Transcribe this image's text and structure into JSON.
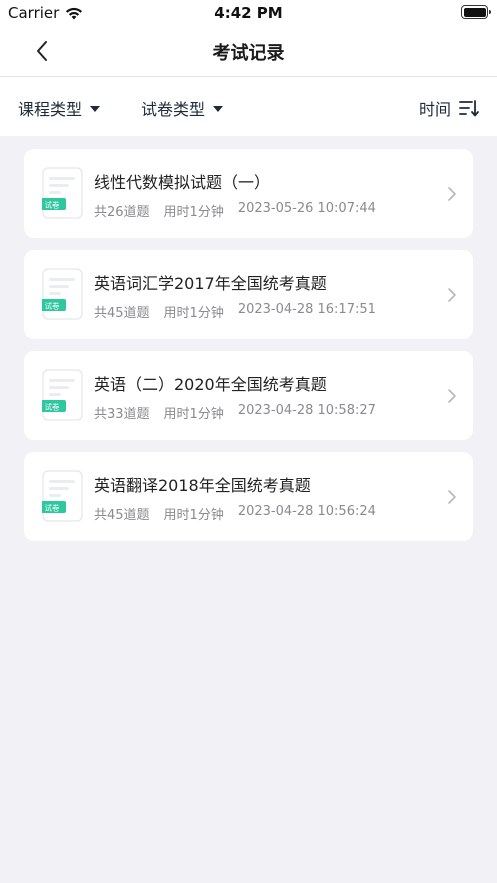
{
  "status": {
    "carrier": "Carrier",
    "time": "4:42 PM"
  },
  "nav": {
    "title": "考试记录"
  },
  "filters": {
    "course_type": "课程类型",
    "paper_type": "试卷类型",
    "time": "时间"
  },
  "records": [
    {
      "title": "线性代数模拟试题（一）",
      "count": "共26道题",
      "duration": "用时1分钟",
      "datetime": "2023-05-26 10:07:44",
      "badge": "试卷"
    },
    {
      "title": "英语词汇学2017年全国统考真题",
      "count": "共45道题",
      "duration": "用时1分钟",
      "datetime": "2023-04-28 16:17:51",
      "badge": "试卷"
    },
    {
      "title": "英语（二）2020年全国统考真题",
      "count": "共33道题",
      "duration": "用时1分钟",
      "datetime": "2023-04-28 10:58:27",
      "badge": "试卷"
    },
    {
      "title": "英语翻译2018年全国统考真题",
      "count": "共45道题",
      "duration": "用时1分钟",
      "datetime": "2023-04-28 10:56:24",
      "badge": "试卷"
    }
  ],
  "colors": {
    "accent": "#2ec7a0",
    "background": "#f2f2f6"
  },
  "icons": {
    "back": "chevron-left-icon",
    "sort": "sort-icon",
    "doc": "document-icon",
    "row": "chevron-right-icon"
  }
}
